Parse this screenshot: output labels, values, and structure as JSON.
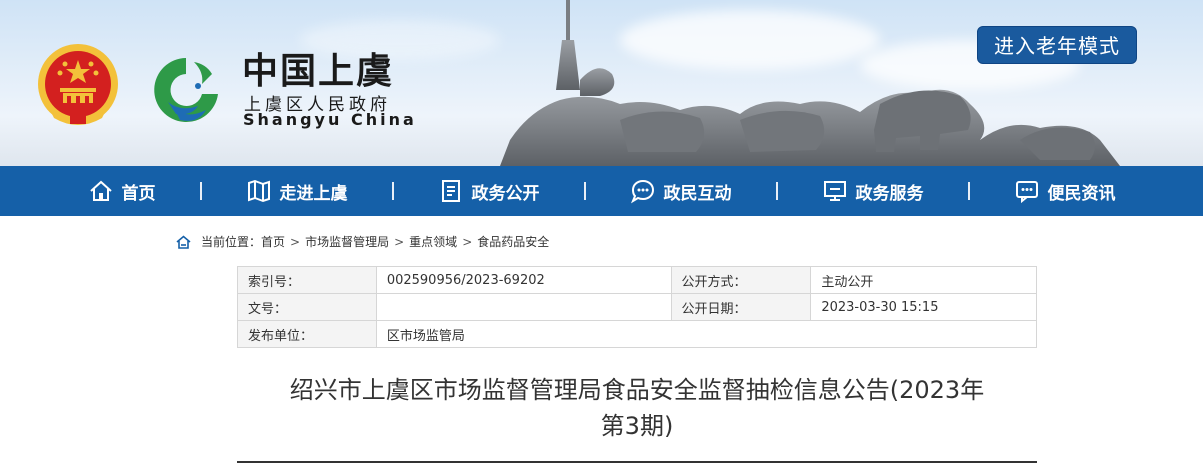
{
  "header": {
    "site_title": "中国上虞",
    "site_subtitle": "上虞区人民政府",
    "site_english": "Shangyu China",
    "elder_mode_button": "进入老年模式"
  },
  "nav": {
    "items": [
      {
        "label": "首页",
        "icon": "home-icon"
      },
      {
        "label": "走进上虞",
        "icon": "map-icon"
      },
      {
        "label": "政务公开",
        "icon": "document-icon"
      },
      {
        "label": "政民互动",
        "icon": "chat-icon"
      },
      {
        "label": "政务服务",
        "icon": "monitor-icon"
      },
      {
        "label": "便民资讯",
        "icon": "message-icon"
      }
    ]
  },
  "breadcrumb": {
    "prefix": "当前位置：",
    "items": [
      "首页",
      "市场监督管理局",
      "重点领域",
      "食品药品安全"
    ],
    "separator": ">"
  },
  "info_table": {
    "index_label": "索引号：",
    "index_value": "002590956/2023-69202",
    "method_label": "公开方式：",
    "method_value": "主动公开",
    "doc_label": "文号：",
    "doc_value": "",
    "date_label": "公开日期：",
    "date_value": "2023-03-30 15:15",
    "publisher_label": "发布单位：",
    "publisher_value": "区市场监管局"
  },
  "article": {
    "title_line1": "绍兴市上虞区市场监督管理局食品安全监督抽检信息公告(2023年",
    "title_line2": "第3期)"
  },
  "colors": {
    "nav_blue": "#1560a8",
    "elder_button_blue": "#1a5a9e",
    "emblem_red": "#d3201f",
    "emblem_gold": "#f3c13a",
    "logo_green": "#2e9a48",
    "logo_blue": "#1e6cb5"
  }
}
